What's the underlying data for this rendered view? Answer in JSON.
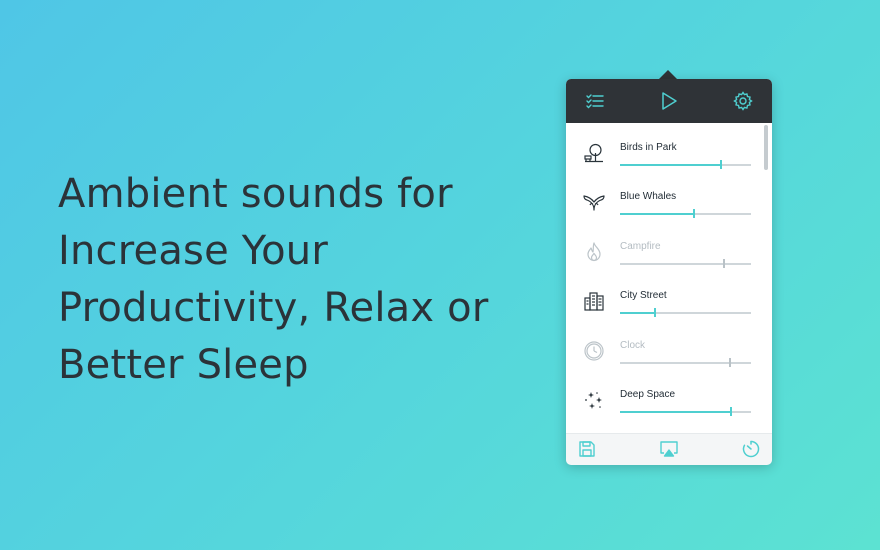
{
  "headline": {
    "lines": [
      "Ambient sounds for",
      "Increase Your",
      "Productivity, Relax or",
      "Better Sleep"
    ]
  },
  "toolbar": {
    "presets_icon": "checklist-icon",
    "play_icon": "play-icon",
    "settings_icon": "gear-icon"
  },
  "sounds": [
    {
      "name": "Birds in Park",
      "icon": "tree-icon",
      "enabled": true,
      "volume": 0.76
    },
    {
      "name": "Blue Whales",
      "icon": "whale-tail-icon",
      "enabled": true,
      "volume": 0.56
    },
    {
      "name": "Campfire",
      "icon": "flame-icon",
      "enabled": false,
      "volume": 0.79
    },
    {
      "name": "City Street",
      "icon": "buildings-icon",
      "enabled": true,
      "volume": 0.26
    },
    {
      "name": "Clock",
      "icon": "clock-icon",
      "enabled": false,
      "volume": 0.83
    },
    {
      "name": "Deep Space",
      "icon": "sparkles-icon",
      "enabled": true,
      "volume": 0.84
    }
  ],
  "footer": {
    "save_icon": "save-icon",
    "airplay_icon": "airplay-icon",
    "timer_icon": "timer-icon"
  },
  "colors": {
    "accent": "#4fcfd0",
    "toolbar_bg": "#2f3337",
    "text_dark": "#1f2a33",
    "text_disabled": "#b4bcc2"
  }
}
